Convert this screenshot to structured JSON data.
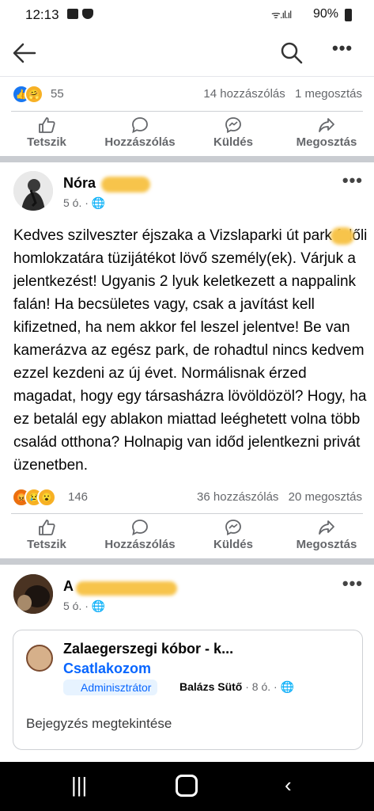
{
  "status_bar": {
    "time": "12:13",
    "signal": "ᯤ.ıl.ıl",
    "battery": "90%"
  },
  "post1_bar": {
    "reaction_count": "55",
    "comments": "14 hozzászólás",
    "shares": "1 megosztás"
  },
  "actions": {
    "like": "Tetszik",
    "comment": "Hozzászólás",
    "send": "Küldés",
    "share": "Megosztás"
  },
  "post2": {
    "name": "Nóra",
    "time": "5 ó. ·",
    "text": "Kedves szilveszter éjszaka a Vizslaparki út park felőli homlokzatára tüzijátékot lövő személy(ek). Várjuk a jelentkezést! Ugyanis 2 lyuk keletkezett a nappalink falán! Ha becsületes vagy, csak a javítást kell kifizetned, ha nem akkor fel leszel jelentve! Be van kamerázva az egész park, de rohadtul nincs kedvem ezzel kezdeni az új évet. Normálisnak érzed magadat, hogy egy társasházra lövöldözöl? Hogy, ha ez betalál egy ablakon miattad leéghetett volna több család otthona? Holnapig van időd jelentkezni privát üzenetben.",
    "reaction_count": "146",
    "comments": "36 hozzászólás",
    "shares": "20 megosztás"
  },
  "post3": {
    "name": "A",
    "time": "5 ó. ·",
    "shared": {
      "group_name": "Zalaegerszegi kóbor - k...",
      "join": "Csatlakozom",
      "badge": "Adminisztrátor",
      "author": "Balázs Sütő",
      "author_time": "· 8 ó. ·",
      "view": "Bejegyzés megtekintése"
    }
  },
  "colors": {
    "accent": "#0866ff",
    "muted": "#65676b",
    "separator": "#c9ccd1"
  }
}
